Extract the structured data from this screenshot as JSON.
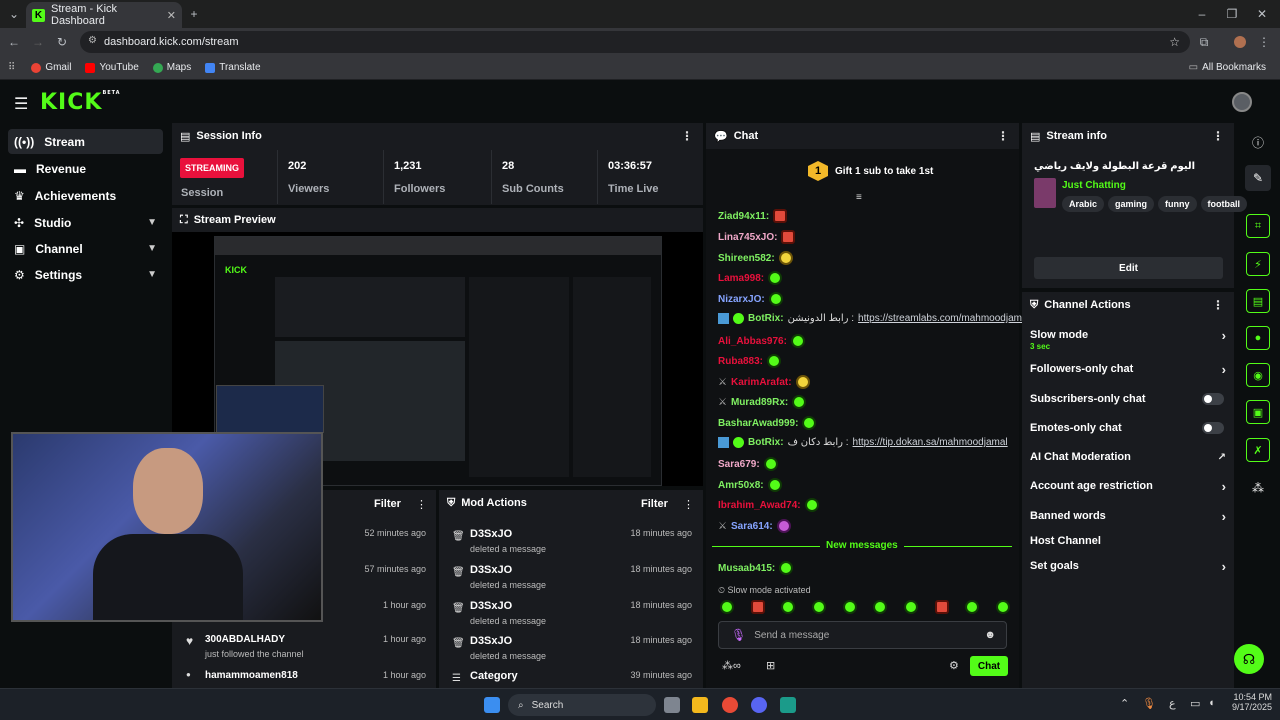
{
  "browser": {
    "tab_title": "Stream - Kick Dashboard",
    "url": "dashboard.kick.com/stream",
    "bookmarks": [
      "Gmail",
      "YouTube",
      "Maps",
      "Translate"
    ],
    "all_bookmarks": "All Bookmarks"
  },
  "kick": {
    "logo": "KICK",
    "logo_beta": "BETA"
  },
  "sidebar": {
    "items": [
      {
        "label": "Stream",
        "icon": "radio-icon"
      },
      {
        "label": "Revenue",
        "icon": "revenue-icon"
      },
      {
        "label": "Achievements",
        "icon": "trophy-icon"
      },
      {
        "label": "Studio",
        "icon": "studio-icon"
      },
      {
        "label": "Channel",
        "icon": "channel-icon"
      },
      {
        "label": "Settings",
        "icon": "gear-icon"
      }
    ]
  },
  "session": {
    "title": "Session Info",
    "badge": "STREAMING",
    "session_label": "Session",
    "stats": [
      {
        "value": "202",
        "label": "Viewers"
      },
      {
        "value": "1,231",
        "label": "Followers"
      },
      {
        "value": "28",
        "label": "Sub Counts"
      },
      {
        "value": "03:36:57",
        "label": "Time Live"
      }
    ]
  },
  "preview": {
    "title": "Stream Preview"
  },
  "activity": {
    "filter": "Filter",
    "times": [
      "52 minutes ago",
      "57 minutes ago",
      "1 hour ago",
      "1 hour ago",
      "1 hour ago"
    ],
    "user1": "300ABDALHADY",
    "user1_action": "just followed the channel",
    "user2": "hamammoamen818"
  },
  "mod": {
    "title": "Mod Actions",
    "filter": "Filter",
    "rows": [
      {
        "user": "D3SxJO",
        "action": "deleted a message",
        "time": "18 minutes ago"
      },
      {
        "user": "D3SxJO",
        "action": "deleted a message",
        "time": "18 minutes ago"
      },
      {
        "user": "D3SxJO",
        "action": "deleted a message",
        "time": "18 minutes ago"
      },
      {
        "user": "D3SxJO",
        "action": "deleted a message",
        "time": "18 minutes ago"
      }
    ],
    "last_user": "Category",
    "last_time": "39 minutes ago"
  },
  "chat": {
    "title": "Chat",
    "gift_count": "1",
    "gift_text": "Gift 1 sub to take 1st",
    "messages": [
      {
        "user": "Ziad94x11:",
        "color": "#7ff062"
      },
      {
        "user": "Lina745xJO:",
        "color": "#f0a8c8"
      },
      {
        "user": "Shireen582:",
        "color": "#7ff062"
      },
      {
        "user": "Lama998:",
        "color": "#e9113c"
      },
      {
        "user": "NizarxJO:",
        "color": "#86a4ff"
      },
      {
        "user": "BotRix:",
        "color": "#7ff062",
        "text": "رابط الدونيشن :",
        "link": "https://streamlabs.com/mahmoodjamal2"
      },
      {
        "user": "Ali_Abbas976:",
        "color": "#e9113c"
      },
      {
        "user": "Ruba883:",
        "color": "#e9113c"
      },
      {
        "user": "KarimArafat:",
        "color": "#e9113c"
      },
      {
        "user": "Murad89Rx:",
        "color": "#7ff062"
      },
      {
        "user": "BasharAwad999:",
        "color": "#7ff062"
      },
      {
        "user": "BotRix:",
        "color": "#7ff062",
        "text": "رابط دكان ف :",
        "link": "https://tip.dokan.sa/mahmoodjamal"
      },
      {
        "user": "Sara679:",
        "color": "#f0a8c8"
      },
      {
        "user": "Amr50x8:",
        "color": "#7ff062"
      },
      {
        "user": "Ibrahim_Awad74:",
        "color": "#e9113c"
      },
      {
        "user": "Sara614:",
        "color": "#86a4ff"
      }
    ],
    "new_messages": "New messages",
    "last_user": "Musaab415:",
    "slow_mode": "Slow mode activated",
    "placeholder": "Send a message",
    "send_label": "Chat"
  },
  "stream_info": {
    "title": "Stream info",
    "stream_title": "اليوم قرعة البطولة ولايف رياضي",
    "category": "Just Chatting",
    "tags": [
      "Arabic",
      "gaming",
      "funny",
      "football"
    ],
    "edit": "Edit"
  },
  "channel_actions": {
    "title": "Channel Actions",
    "slow_mode": "Slow mode",
    "slow_mode_value": "3 sec",
    "items": [
      "Followers-only chat",
      "Subscribers-only chat",
      "Emotes-only chat",
      "AI Chat Moderation",
      "Account age restriction",
      "Banned words",
      "Host Channel",
      "Set goals"
    ]
  },
  "taskbar": {
    "search": "Search",
    "time": "10:54 PM",
    "date": "9/17/2025",
    "lang": "ع"
  },
  "colors": {
    "accent": "#53fc18",
    "live": "#e9113c",
    "panel": "#191b1f"
  }
}
